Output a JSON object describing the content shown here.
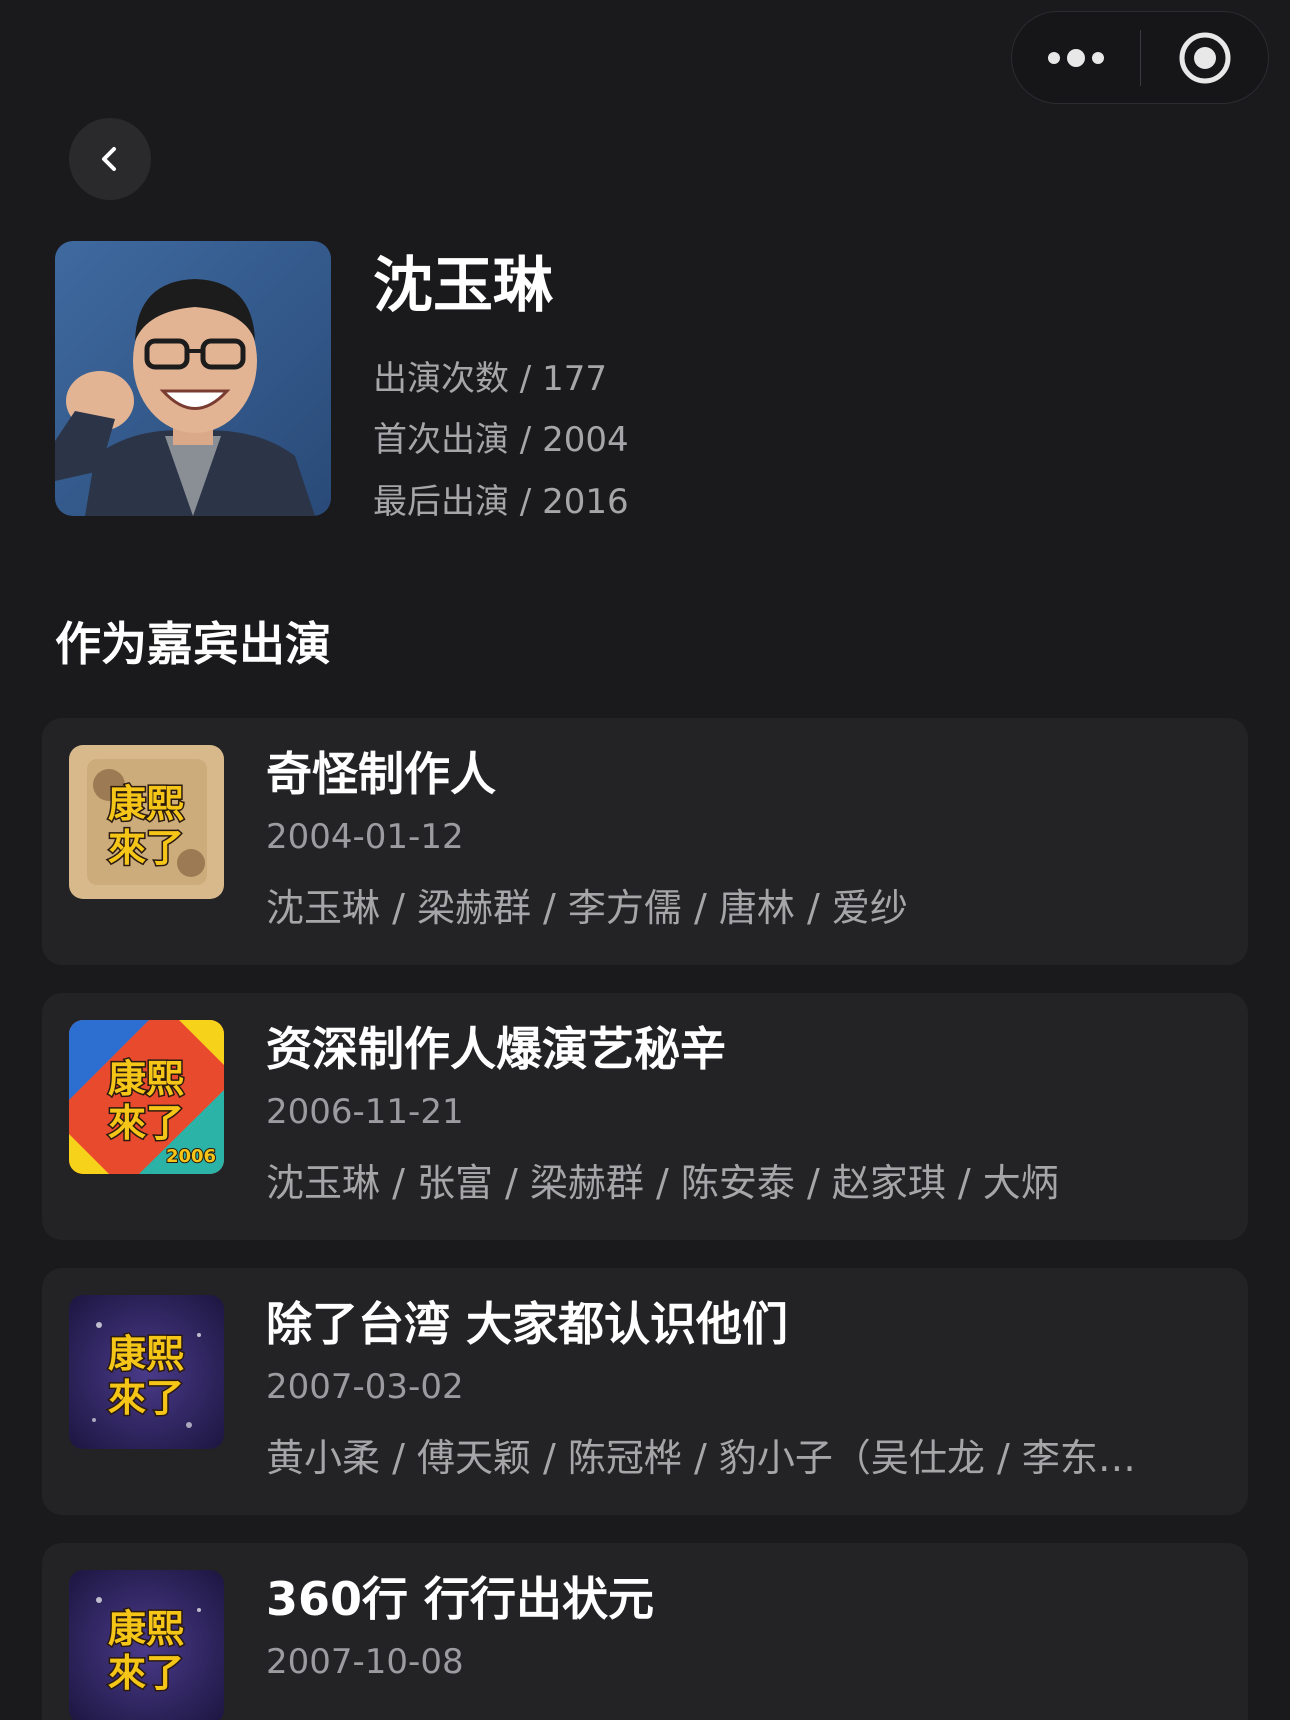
{
  "capsule": {
    "more_icon": "more-dots-icon",
    "close_icon": "target-close-icon"
  },
  "back_icon": "chevron-left-icon",
  "profile": {
    "name": "沈玉琳",
    "stats": [
      {
        "label": "出演次数 / 177"
      },
      {
        "label": "首次出演 / 2004"
      },
      {
        "label": "最后出演 / 2016"
      }
    ]
  },
  "section_title": "作为嘉宾出演",
  "episodes": [
    {
      "title": "奇怪制作人",
      "date": "2004-01-12",
      "cast": "沈玉琳 / 梁赫群 / 李方儒 / 唐林 / 爱纱",
      "thumb_style": "beige",
      "logo_top": "康熙",
      "logo_bottom": "來了"
    },
    {
      "title": "资深制作人爆演艺秘辛",
      "date": "2006-11-21",
      "cast": "沈玉琳 / 张富 / 梁赫群 / 陈安泰 / 赵家琪 / 大炳",
      "thumb_style": "comic",
      "logo_top": "康熙",
      "logo_bottom": "來了",
      "logo_year": "2006"
    },
    {
      "title": "除了台湾 大家都认识他们",
      "date": "2007-03-02",
      "cast": "黄小柔 / 傅天颖 / 陈冠桦 / 豹小子（吴仕龙 / 李东…",
      "thumb_style": "space",
      "logo_top": "康熙",
      "logo_bottom": "來了"
    },
    {
      "title": "360行 行行出状元",
      "date": "2007-10-08",
      "cast": "",
      "thumb_style": "space",
      "logo_top": "康熙",
      "logo_bottom": "來了"
    }
  ]
}
